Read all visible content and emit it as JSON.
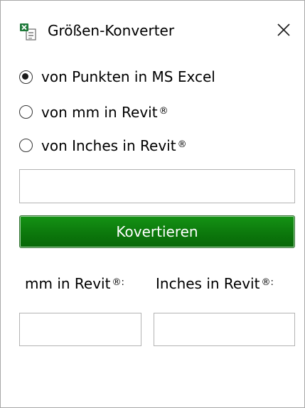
{
  "window": {
    "title": "Größen-Konverter",
    "icon": "excel-file-icon",
    "close_glyph": "✕"
  },
  "options": [
    {
      "label": "von Punkten in MS Excel",
      "suffix": "",
      "selected": true
    },
    {
      "label": "von mm in Revit",
      "suffix": "®",
      "selected": false
    },
    {
      "label": "von Inches in Revit",
      "suffix": "®",
      "selected": false
    }
  ],
  "input": {
    "value": ""
  },
  "convert_button": {
    "label": "Kovertieren",
    "color": "#0e800e"
  },
  "results": {
    "mm_label": "mm in Revit",
    "mm_suffix": "®:",
    "mm_value": "",
    "inch_label": "Inches in Revit",
    "inch_suffix": "®:",
    "inch_value": ""
  }
}
